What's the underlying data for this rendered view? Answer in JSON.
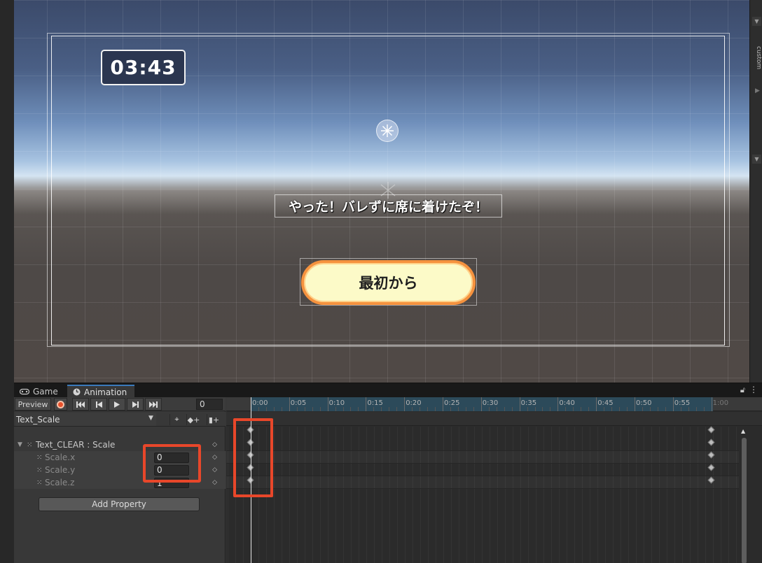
{
  "scene": {
    "timer_text": "03:43",
    "clear_message": "やった！バレずに席に着けたぞ！",
    "restart_button_label": "最初から"
  },
  "inspector": {
    "side_label": "custom"
  },
  "tabs": [
    {
      "label": "Game",
      "icon": "gamepad-icon",
      "active": false
    },
    {
      "label": "Animation",
      "icon": "clock-icon",
      "active": true
    }
  ],
  "animation": {
    "preview_label": "Preview",
    "frame_value": "0",
    "clip_name": "Text_Scale",
    "properties": [
      {
        "label": "Text_CLEAR : Scale",
        "value": null
      },
      {
        "label": "Scale.x",
        "value": "0"
      },
      {
        "label": "Scale.y",
        "value": "0"
      },
      {
        "label": "Scale.z",
        "value": "1"
      }
    ],
    "add_property_label": "Add Property",
    "timeline_ticks": [
      "0:00",
      "0:05",
      "0:10",
      "0:15",
      "0:20",
      "0:25",
      "0:30",
      "0:35",
      "0:40",
      "0:45",
      "0:50",
      "0:55",
      "1:00"
    ],
    "keyframes_at": [
      "0:00",
      "1:00"
    ]
  },
  "colors": {
    "record": "#e8502b",
    "button_fill": "#fcfac8",
    "button_border": "#f5923e",
    "highlight": "#e8472a",
    "tab_accent": "#3a79bb"
  }
}
